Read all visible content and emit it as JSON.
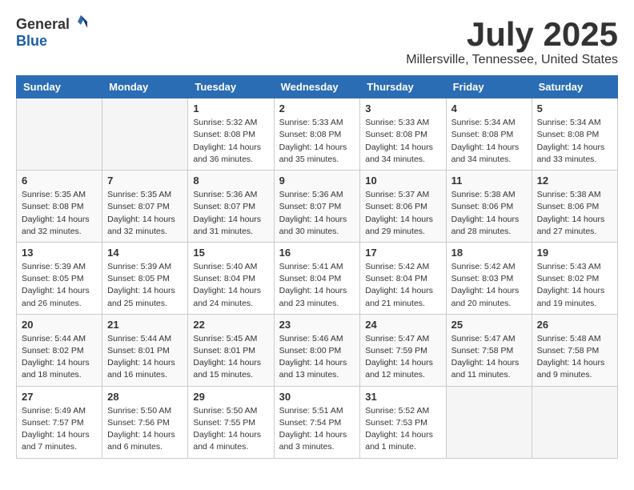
{
  "header": {
    "logo_general": "General",
    "logo_blue": "Blue",
    "month_title": "July 2025",
    "location": "Millersville, Tennessee, United States"
  },
  "calendar": {
    "days_of_week": [
      "Sunday",
      "Monday",
      "Tuesday",
      "Wednesday",
      "Thursday",
      "Friday",
      "Saturday"
    ],
    "weeks": [
      [
        {
          "day": "",
          "empty": true
        },
        {
          "day": "",
          "empty": true
        },
        {
          "day": "1",
          "sunrise": "Sunrise: 5:32 AM",
          "sunset": "Sunset: 8:08 PM",
          "daylight": "Daylight: 14 hours and 36 minutes."
        },
        {
          "day": "2",
          "sunrise": "Sunrise: 5:33 AM",
          "sunset": "Sunset: 8:08 PM",
          "daylight": "Daylight: 14 hours and 35 minutes."
        },
        {
          "day": "3",
          "sunrise": "Sunrise: 5:33 AM",
          "sunset": "Sunset: 8:08 PM",
          "daylight": "Daylight: 14 hours and 34 minutes."
        },
        {
          "day": "4",
          "sunrise": "Sunrise: 5:34 AM",
          "sunset": "Sunset: 8:08 PM",
          "daylight": "Daylight: 14 hours and 34 minutes."
        },
        {
          "day": "5",
          "sunrise": "Sunrise: 5:34 AM",
          "sunset": "Sunset: 8:08 PM",
          "daylight": "Daylight: 14 hours and 33 minutes."
        }
      ],
      [
        {
          "day": "6",
          "sunrise": "Sunrise: 5:35 AM",
          "sunset": "Sunset: 8:08 PM",
          "daylight": "Daylight: 14 hours and 32 minutes."
        },
        {
          "day": "7",
          "sunrise": "Sunrise: 5:35 AM",
          "sunset": "Sunset: 8:07 PM",
          "daylight": "Daylight: 14 hours and 32 minutes."
        },
        {
          "day": "8",
          "sunrise": "Sunrise: 5:36 AM",
          "sunset": "Sunset: 8:07 PM",
          "daylight": "Daylight: 14 hours and 31 minutes."
        },
        {
          "day": "9",
          "sunrise": "Sunrise: 5:36 AM",
          "sunset": "Sunset: 8:07 PM",
          "daylight": "Daylight: 14 hours and 30 minutes."
        },
        {
          "day": "10",
          "sunrise": "Sunrise: 5:37 AM",
          "sunset": "Sunset: 8:06 PM",
          "daylight": "Daylight: 14 hours and 29 minutes."
        },
        {
          "day": "11",
          "sunrise": "Sunrise: 5:38 AM",
          "sunset": "Sunset: 8:06 PM",
          "daylight": "Daylight: 14 hours and 28 minutes."
        },
        {
          "day": "12",
          "sunrise": "Sunrise: 5:38 AM",
          "sunset": "Sunset: 8:06 PM",
          "daylight": "Daylight: 14 hours and 27 minutes."
        }
      ],
      [
        {
          "day": "13",
          "sunrise": "Sunrise: 5:39 AM",
          "sunset": "Sunset: 8:05 PM",
          "daylight": "Daylight: 14 hours and 26 minutes."
        },
        {
          "day": "14",
          "sunrise": "Sunrise: 5:39 AM",
          "sunset": "Sunset: 8:05 PM",
          "daylight": "Daylight: 14 hours and 25 minutes."
        },
        {
          "day": "15",
          "sunrise": "Sunrise: 5:40 AM",
          "sunset": "Sunset: 8:04 PM",
          "daylight": "Daylight: 14 hours and 24 minutes."
        },
        {
          "day": "16",
          "sunrise": "Sunrise: 5:41 AM",
          "sunset": "Sunset: 8:04 PM",
          "daylight": "Daylight: 14 hours and 23 minutes."
        },
        {
          "day": "17",
          "sunrise": "Sunrise: 5:42 AM",
          "sunset": "Sunset: 8:04 PM",
          "daylight": "Daylight: 14 hours and 21 minutes."
        },
        {
          "day": "18",
          "sunrise": "Sunrise: 5:42 AM",
          "sunset": "Sunset: 8:03 PM",
          "daylight": "Daylight: 14 hours and 20 minutes."
        },
        {
          "day": "19",
          "sunrise": "Sunrise: 5:43 AM",
          "sunset": "Sunset: 8:02 PM",
          "daylight": "Daylight: 14 hours and 19 minutes."
        }
      ],
      [
        {
          "day": "20",
          "sunrise": "Sunrise: 5:44 AM",
          "sunset": "Sunset: 8:02 PM",
          "daylight": "Daylight: 14 hours and 18 minutes."
        },
        {
          "day": "21",
          "sunrise": "Sunrise: 5:44 AM",
          "sunset": "Sunset: 8:01 PM",
          "daylight": "Daylight: 14 hours and 16 minutes."
        },
        {
          "day": "22",
          "sunrise": "Sunrise: 5:45 AM",
          "sunset": "Sunset: 8:01 PM",
          "daylight": "Daylight: 14 hours and 15 minutes."
        },
        {
          "day": "23",
          "sunrise": "Sunrise: 5:46 AM",
          "sunset": "Sunset: 8:00 PM",
          "daylight": "Daylight: 14 hours and 13 minutes."
        },
        {
          "day": "24",
          "sunrise": "Sunrise: 5:47 AM",
          "sunset": "Sunset: 7:59 PM",
          "daylight": "Daylight: 14 hours and 12 minutes."
        },
        {
          "day": "25",
          "sunrise": "Sunrise: 5:47 AM",
          "sunset": "Sunset: 7:58 PM",
          "daylight": "Daylight: 14 hours and 11 minutes."
        },
        {
          "day": "26",
          "sunrise": "Sunrise: 5:48 AM",
          "sunset": "Sunset: 7:58 PM",
          "daylight": "Daylight: 14 hours and 9 minutes."
        }
      ],
      [
        {
          "day": "27",
          "sunrise": "Sunrise: 5:49 AM",
          "sunset": "Sunset: 7:57 PM",
          "daylight": "Daylight: 14 hours and 7 minutes."
        },
        {
          "day": "28",
          "sunrise": "Sunrise: 5:50 AM",
          "sunset": "Sunset: 7:56 PM",
          "daylight": "Daylight: 14 hours and 6 minutes."
        },
        {
          "day": "29",
          "sunrise": "Sunrise: 5:50 AM",
          "sunset": "Sunset: 7:55 PM",
          "daylight": "Daylight: 14 hours and 4 minutes."
        },
        {
          "day": "30",
          "sunrise": "Sunrise: 5:51 AM",
          "sunset": "Sunset: 7:54 PM",
          "daylight": "Daylight: 14 hours and 3 minutes."
        },
        {
          "day": "31",
          "sunrise": "Sunrise: 5:52 AM",
          "sunset": "Sunset: 7:53 PM",
          "daylight": "Daylight: 14 hours and 1 minute."
        },
        {
          "day": "",
          "empty": true
        },
        {
          "day": "",
          "empty": true
        }
      ]
    ]
  }
}
